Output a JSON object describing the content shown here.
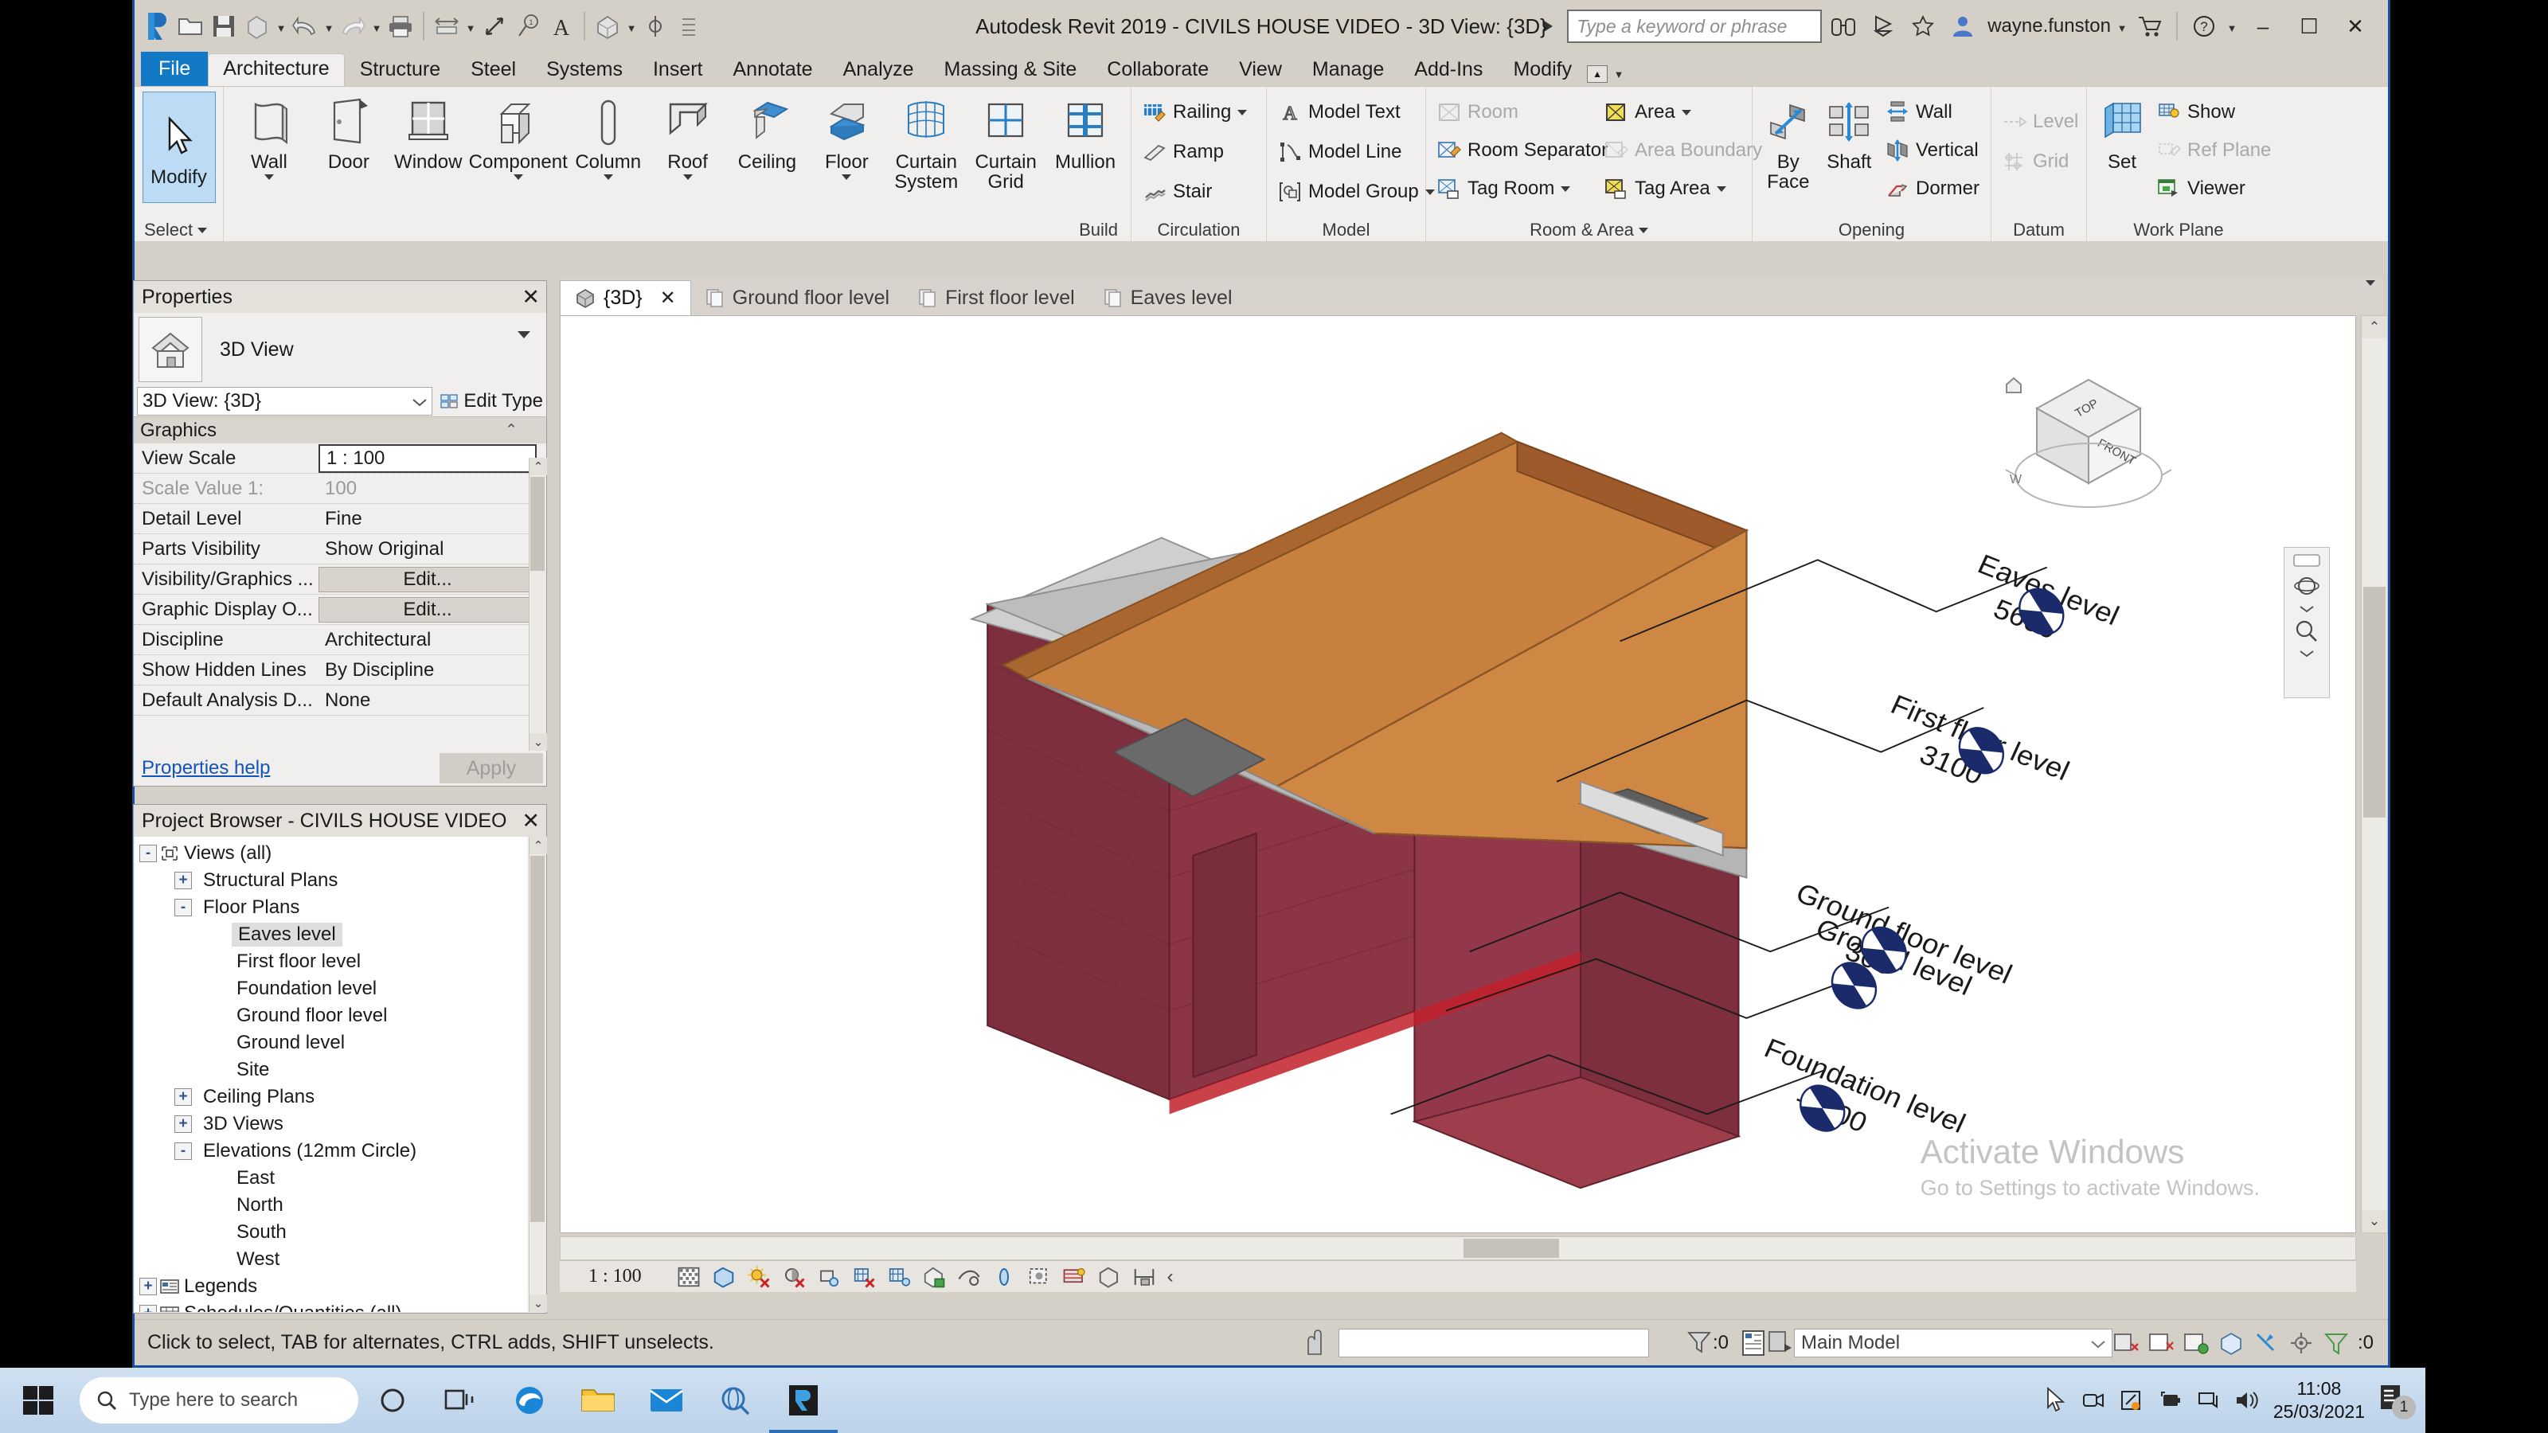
{
  "app": {
    "title": "Autodesk Revit 2019 - CIVILS HOUSE VIDEO - 3D View: {3D}",
    "search_placeholder": "Type a keyword or phrase",
    "username": "wayne.funston",
    "minimize": "–",
    "maximize": "☐",
    "close": "✕"
  },
  "quick_access": [
    {
      "name": "revit-logo-icon"
    },
    {
      "name": "open-icon"
    },
    {
      "name": "save-icon"
    },
    {
      "name": "save-as-icon"
    },
    {
      "name": "undo-icon"
    },
    {
      "name": "redo-icon"
    },
    {
      "name": "print-icon"
    },
    {
      "name": "measure-icon"
    },
    {
      "name": "aligned-dimension-icon"
    },
    {
      "name": "tag-icon"
    },
    {
      "name": "text-icon"
    },
    {
      "name": "default-3d-view-icon"
    },
    {
      "name": "section-icon"
    },
    {
      "name": "thin-lines-icon"
    }
  ],
  "ribbon": {
    "tabs": [
      {
        "label": "File",
        "kind": "file"
      },
      {
        "label": "Architecture",
        "kind": "active"
      },
      {
        "label": "Structure",
        "kind": "normal"
      },
      {
        "label": "Steel",
        "kind": "normal"
      },
      {
        "label": "Systems",
        "kind": "normal"
      },
      {
        "label": "Insert",
        "kind": "normal"
      },
      {
        "label": "Annotate",
        "kind": "normal"
      },
      {
        "label": "Analyze",
        "kind": "normal"
      },
      {
        "label": "Massing & Site",
        "kind": "normal"
      },
      {
        "label": "Collaborate",
        "kind": "normal"
      },
      {
        "label": "View",
        "kind": "normal"
      },
      {
        "label": "Manage",
        "kind": "normal"
      },
      {
        "label": "Add-Ins",
        "kind": "normal"
      },
      {
        "label": "Modify",
        "kind": "normal"
      }
    ],
    "panels": {
      "select": {
        "title": "Select",
        "modify": "Modify"
      },
      "build": {
        "title": "Build",
        "items": [
          {
            "label": "Wall",
            "dropdown": true
          },
          {
            "label": "Door",
            "dropdown": false
          },
          {
            "label": "Window",
            "dropdown": false
          },
          {
            "label": "Component",
            "dropdown": true
          },
          {
            "label": "Column",
            "dropdown": true
          },
          {
            "label": "Roof",
            "dropdown": true
          },
          {
            "label": "Ceiling",
            "dropdown": false
          },
          {
            "label": "Floor",
            "dropdown": true
          },
          {
            "label": "Curtain System",
            "dropdown": false
          },
          {
            "label": "Curtain Grid",
            "dropdown": false
          },
          {
            "label": "Mullion",
            "dropdown": false
          }
        ]
      },
      "circulation": {
        "title": "Circulation",
        "items": [
          {
            "label": "Railing",
            "dropdown": true,
            "disabled": false
          },
          {
            "label": "Ramp",
            "dropdown": false,
            "disabled": false
          },
          {
            "label": "Stair",
            "dropdown": false,
            "disabled": false
          }
        ]
      },
      "model": {
        "title": "Model",
        "items": [
          {
            "label": "Model Text",
            "dropdown": false,
            "disabled": false
          },
          {
            "label": "Model Line",
            "dropdown": false,
            "disabled": false
          },
          {
            "label": "Model Group",
            "dropdown": true,
            "disabled": false
          }
        ]
      },
      "room_area": {
        "title": "Room & Area",
        "col1": [
          {
            "label": "Room",
            "dropdown": false,
            "disabled": true
          },
          {
            "label": "Room Separator",
            "dropdown": false,
            "disabled": false
          },
          {
            "label": "Tag Room",
            "dropdown": true,
            "disabled": false
          }
        ],
        "col2": [
          {
            "label": "Area",
            "dropdown": true,
            "disabled": false
          },
          {
            "label": "Area Boundary",
            "dropdown": false,
            "disabled": true
          },
          {
            "label": "Tag Area",
            "dropdown": true,
            "disabled": false
          }
        ]
      },
      "opening": {
        "title": "Opening",
        "big": [
          {
            "label": "By Face"
          },
          {
            "label": "Shaft"
          }
        ],
        "small": [
          {
            "label": "Wall",
            "disabled": false
          },
          {
            "label": "Vertical",
            "disabled": false
          },
          {
            "label": "Dormer",
            "disabled": false
          }
        ]
      },
      "datum": {
        "title": "Datum",
        "items": [
          {
            "label": "Level",
            "disabled": true
          },
          {
            "label": "Grid",
            "disabled": true
          }
        ]
      },
      "workplane": {
        "title": "Work Plane",
        "big": [
          {
            "label": "Set"
          }
        ],
        "small": [
          {
            "label": "Show",
            "disabled": false
          },
          {
            "label": "Ref Plane",
            "disabled": true
          },
          {
            "label": "Viewer",
            "disabled": false
          }
        ]
      }
    }
  },
  "properties": {
    "title": "Properties",
    "close": "✕",
    "type_name": "3D View",
    "type_instance": "3D View: {3D}",
    "edit_type": "Edit Type",
    "group": "Graphics",
    "rows": [
      {
        "name": "View Scale",
        "value": "1 : 100",
        "style": "focus"
      },
      {
        "name": "Scale Value    1:",
        "value": "100",
        "style": "dim"
      },
      {
        "name": "Detail Level",
        "value": "Fine",
        "style": "normal"
      },
      {
        "name": "Parts Visibility",
        "value": "Show Original",
        "style": "normal"
      },
      {
        "name": "Visibility/Graphics ...",
        "value": "Edit...",
        "style": "button"
      },
      {
        "name": "Graphic Display O...",
        "value": "Edit...",
        "style": "button"
      },
      {
        "name": "Discipline",
        "value": "Architectural",
        "style": "normal"
      },
      {
        "name": "Show Hidden Lines",
        "value": "By Discipline",
        "style": "normal"
      },
      {
        "name": "Default Analysis D...",
        "value": "None",
        "style": "normal"
      }
    ],
    "help_link": "Properties help",
    "apply": "Apply"
  },
  "project_browser": {
    "title": "Project Browser - CIVILS HOUSE VIDEO",
    "close": "✕",
    "nodes": [
      {
        "label": "Views (all)",
        "indent": 0,
        "toggle": "-",
        "icon": "views-icon",
        "selected": false
      },
      {
        "label": "Structural Plans",
        "indent": 1,
        "toggle": "+",
        "icon": "",
        "selected": false
      },
      {
        "label": "Floor Plans",
        "indent": 1,
        "toggle": "-",
        "icon": "",
        "selected": false
      },
      {
        "label": "Eaves level",
        "indent": 2,
        "toggle": "",
        "icon": "",
        "selected": true
      },
      {
        "label": "First floor level",
        "indent": 2,
        "toggle": "",
        "icon": "",
        "selected": false
      },
      {
        "label": "Foundation level",
        "indent": 2,
        "toggle": "",
        "icon": "",
        "selected": false
      },
      {
        "label": "Ground floor level",
        "indent": 2,
        "toggle": "",
        "icon": "",
        "selected": false
      },
      {
        "label": "Ground level",
        "indent": 2,
        "toggle": "",
        "icon": "",
        "selected": false
      },
      {
        "label": "Site",
        "indent": 2,
        "toggle": "",
        "icon": "",
        "selected": false
      },
      {
        "label": "Ceiling Plans",
        "indent": 1,
        "toggle": "+",
        "icon": "",
        "selected": false
      },
      {
        "label": "3D Views",
        "indent": 1,
        "toggle": "+",
        "icon": "",
        "selected": false
      },
      {
        "label": "Elevations (12mm Circle)",
        "indent": 1,
        "toggle": "-",
        "icon": "",
        "selected": false
      },
      {
        "label": "East",
        "indent": 2,
        "toggle": "",
        "icon": "",
        "selected": false
      },
      {
        "label": "North",
        "indent": 2,
        "toggle": "",
        "icon": "",
        "selected": false
      },
      {
        "label": "South",
        "indent": 2,
        "toggle": "",
        "icon": "",
        "selected": false
      },
      {
        "label": "West",
        "indent": 2,
        "toggle": "",
        "icon": "",
        "selected": false
      },
      {
        "label": "Legends",
        "indent": 0,
        "toggle": "+",
        "icon": "legend-icon",
        "selected": false
      },
      {
        "label": "Schedules/Quantities (all)",
        "indent": 0,
        "toggle": "+",
        "icon": "schedule-icon",
        "selected": false
      }
    ]
  },
  "view_tabs": [
    {
      "label": "{3D}",
      "active": true,
      "closable": true
    },
    {
      "label": "Ground floor level",
      "active": false,
      "closable": false
    },
    {
      "label": "First floor level",
      "active": false,
      "closable": false
    },
    {
      "label": "Eaves level",
      "active": false,
      "closable": false
    }
  ],
  "canvas": {
    "viewcube": {
      "top": "TOP",
      "front": "FRONT",
      "left": "W"
    },
    "levels": [
      {
        "name": "Eaves level",
        "elevation": "5600"
      },
      {
        "name": "First floor level",
        "elevation": "3100"
      },
      {
        "name": "Ground floor level",
        "elevation": "300"
      },
      {
        "name": "Ground level",
        "elevation": "0"
      },
      {
        "name": "Foundation level",
        "elevation": "-1500"
      }
    ],
    "colors": {
      "roof": "#c8803f",
      "roof_dark": "#9e5a2a",
      "wall_brick": "#7e2f3e",
      "wall_brick_dark": "#6a2532",
      "fascia": "#c9c9c9",
      "soffit": "#9a9a9a"
    },
    "watermark_line1": "Activate Windows",
    "watermark_line2": "Go to Settings to activate Windows."
  },
  "view_control_bar": {
    "scale": "1 : 100",
    "icons": [
      "detail-level-fine-icon",
      "visual-style-icon",
      "sun-path-off-icon",
      "shadows-off-icon",
      "rendering-dialog-icon",
      "crop-view-off-icon",
      "show-crop-region-icon",
      "lock-3d-view-icon",
      "temporary-hide-isolate-icon",
      "reveal-hidden-elements-icon",
      "temporary-view-properties-icon",
      "analytical-model-icon",
      "constraints-icon",
      "measure-icon"
    ],
    "more": "‹"
  },
  "status_bar": {
    "message": "Click to select, TAB for alternates, CTRL adds, SHIFT unselects.",
    "filter_count": ":0",
    "worksets": "Main Model",
    "design_options_count": ":0"
  },
  "taskbar": {
    "search_placeholder": "Type here to search",
    "time": "11:08",
    "date": "25/03/2021",
    "notification_count": "1",
    "apps": [
      {
        "name": "cortana-icon"
      },
      {
        "name": "task-view-icon"
      },
      {
        "name": "edge-icon"
      },
      {
        "name": "file-explorer-icon"
      },
      {
        "name": "mail-icon"
      },
      {
        "name": "search-globe-icon"
      },
      {
        "name": "revit-taskbar-icon"
      }
    ],
    "tray": [
      {
        "name": "cursor-icon"
      },
      {
        "name": "camera-icon"
      },
      {
        "name": "onedrive-icon"
      },
      {
        "name": "battery-icon"
      },
      {
        "name": "network-icon"
      },
      {
        "name": "volume-icon"
      }
    ]
  }
}
